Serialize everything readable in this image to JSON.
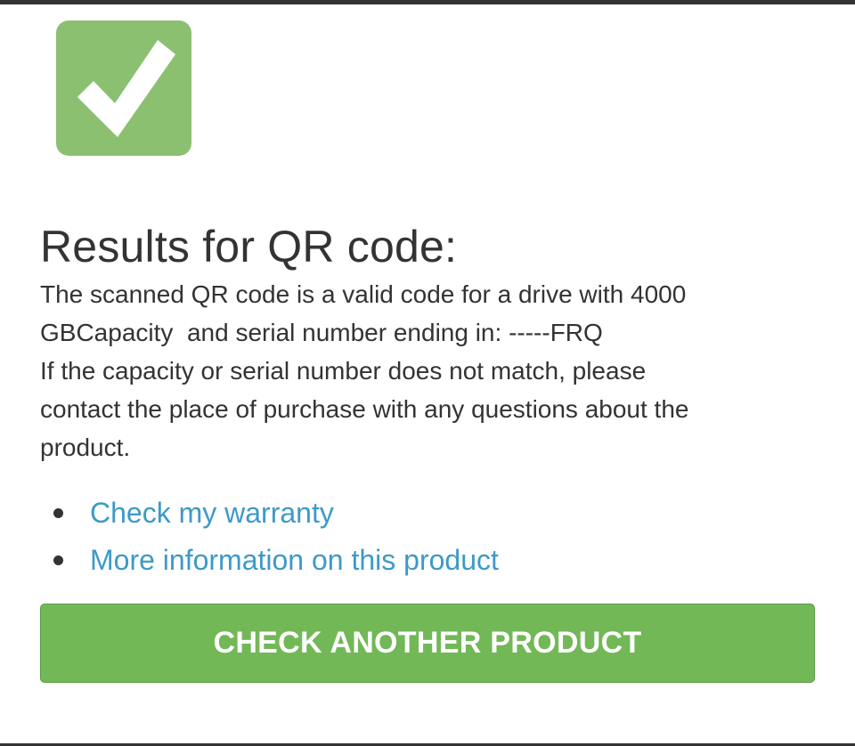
{
  "status": {
    "icon": "checkmark-icon",
    "color": "#8cc071"
  },
  "title": "Results for QR code:",
  "result": {
    "lines": [
      "The scanned QR code is a valid code for a drive with 4000",
      "GBCapacity  and serial number ending in: -----FRQ",
      "If the capacity or serial number does not match, please",
      "contact the place of purchase with any questions about the",
      "product."
    ]
  },
  "links": [
    {
      "label": "Check my warranty"
    },
    {
      "label": "More information on this product"
    }
  ],
  "action": {
    "label": "CHECK ANOTHER PRODUCT",
    "color": "#72b857"
  },
  "colors": {
    "link": "#3c9ac8",
    "text": "#333333"
  }
}
